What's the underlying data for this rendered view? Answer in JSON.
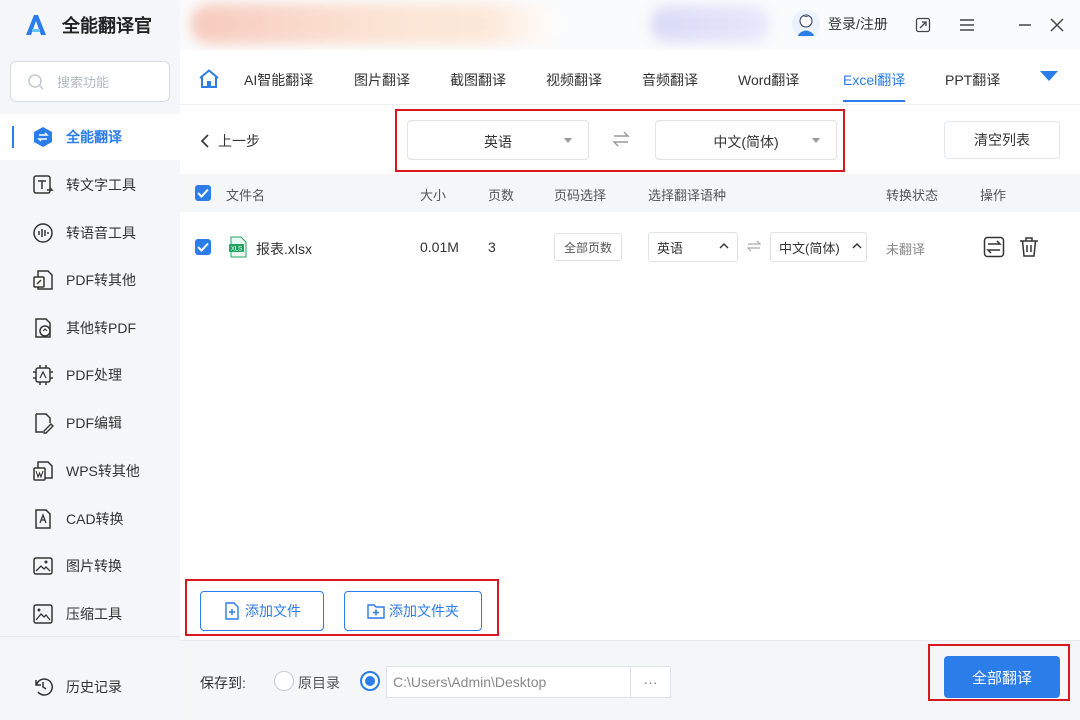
{
  "app": {
    "name": "全能翻译官",
    "accent": "#2b7de9",
    "highlight": "#d9171e"
  },
  "header": {
    "login_label": "登录/注册",
    "icons": [
      "restore-icon",
      "menu-icon",
      "minimize-icon",
      "close-icon"
    ]
  },
  "sidebar": {
    "search_placeholder": "搜索功能",
    "items": [
      {
        "label": "全能翻译",
        "icon": "translate-icon",
        "active": true
      },
      {
        "label": "转文字工具",
        "icon": "text-convert-icon"
      },
      {
        "label": "转语音工具",
        "icon": "voice-icon"
      },
      {
        "label": "PDF转其他",
        "icon": "pdf-export-icon"
      },
      {
        "label": "其他转PDF",
        "icon": "pdf-import-icon"
      },
      {
        "label": "PDF处理",
        "icon": "pdf-process-icon"
      },
      {
        "label": "PDF编辑",
        "icon": "pdf-edit-icon"
      },
      {
        "label": "WPS转其他",
        "icon": "wps-icon"
      },
      {
        "label": "CAD转换",
        "icon": "cad-icon"
      },
      {
        "label": "图片转换",
        "icon": "image-convert-icon"
      },
      {
        "label": "压缩工具",
        "icon": "compress-icon"
      }
    ],
    "history_label": "历史记录"
  },
  "tabs": [
    "AI智能翻译",
    "图片翻译",
    "截图翻译",
    "视频翻译",
    "音频翻译",
    "Word翻译",
    "Excel翻译",
    "PPT翻译"
  ],
  "active_tab": "Excel翻译",
  "toolbar": {
    "back_label": "上一步",
    "source_lang": "英语",
    "target_lang": "中文(简体)",
    "clear_label": "清空列表"
  },
  "table": {
    "headers": [
      "文件名",
      "大小",
      "页数",
      "页码选择",
      "选择翻译语种",
      "转换状态",
      "操作"
    ],
    "rows": [
      {
        "file_badge": "XLS",
        "name": "报表.xlsx",
        "size": "0.01M",
        "pages": "3",
        "page_select": "全部页数",
        "source": "英语",
        "target": "中文(简体)",
        "status": "未翻译"
      }
    ]
  },
  "actions": {
    "add_file": "添加文件",
    "add_folder": "添加文件夹"
  },
  "footer": {
    "save_to": "保存到:",
    "original_dir": "原目录",
    "path": "C:\\Users\\Admin\\Desktop",
    "browse": "···",
    "translate_all": "全部翻译"
  }
}
